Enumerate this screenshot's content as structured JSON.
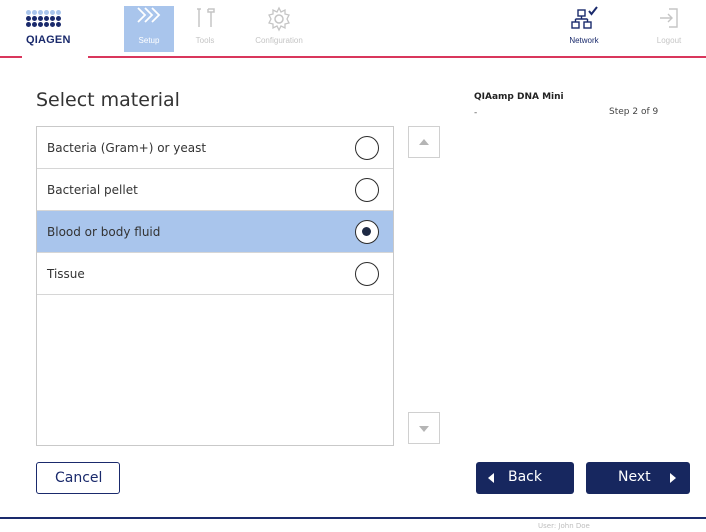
{
  "brand": {
    "logo_text": "QIAGEN",
    "dot_color": "#1a2a6c",
    "dot_color_light": "#a9c5ec",
    "accent_line": "#d9365c"
  },
  "nav": {
    "setup": {
      "label": "Setup",
      "icon": "setup-chevrons-icon"
    },
    "tools": {
      "label": "Tools",
      "icon": "tools-icon"
    },
    "configuration": {
      "label": "Configuration",
      "icon": "gear-icon"
    },
    "network": {
      "label": "Network",
      "icon": "network-connected-icon"
    },
    "logout": {
      "label": "Logout",
      "icon": "logout-icon"
    }
  },
  "main": {
    "title": "Select material",
    "kit_name": "QIAamp DNA Mini",
    "kit_sub": "-",
    "step": "Step 2 of 9",
    "items": [
      {
        "label": "Bacteria (Gram+) or yeast",
        "selected": false
      },
      {
        "label": "Bacterial pellet",
        "selected": false
      },
      {
        "label": "Blood or body fluid",
        "selected": true
      },
      {
        "label": "Tissue",
        "selected": false
      }
    ]
  },
  "buttons": {
    "cancel": "Cancel",
    "back": "Back",
    "next": "Next"
  },
  "footer": {
    "user": "User: John Doe"
  },
  "colors": {
    "selected_row": "#a9c5ec",
    "primary_button": "#17275f"
  }
}
